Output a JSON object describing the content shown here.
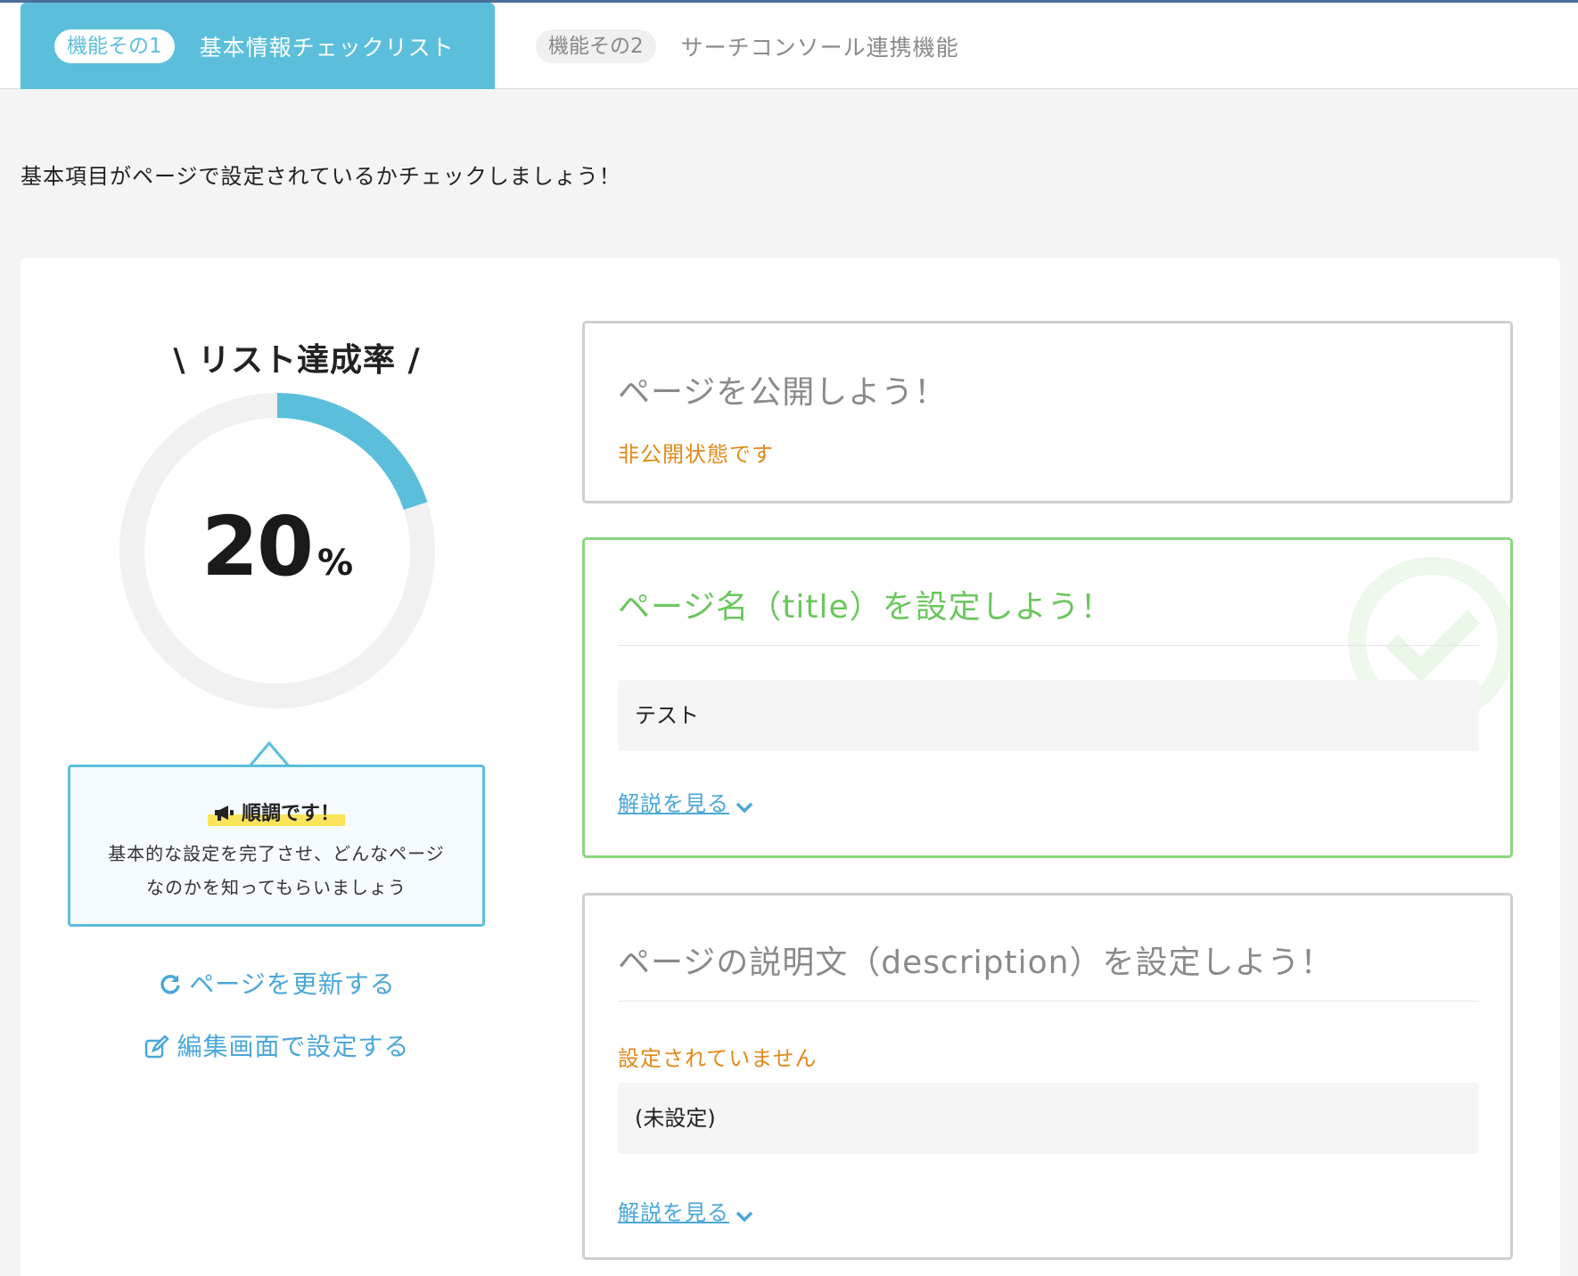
{
  "tabs": [
    {
      "pill": "機能その1",
      "label": "基本情報チェックリスト",
      "active": true
    },
    {
      "pill": "機能その2",
      "label": "サーチコンソール連携機能",
      "active": false
    }
  ],
  "intro": "基本項目がページで設定されているかチェックしましょう！",
  "progress": {
    "title": "\\ リスト達成率 /",
    "value": "20",
    "unit": "%",
    "fraction": 0.2,
    "accent_color": "#5bbfdc"
  },
  "message": {
    "heading": "順調です！",
    "icon": "megaphone-icon",
    "line1": "基本的な設定を完了させ、どんなページ",
    "line2": "なのかを知ってもらいましょう"
  },
  "actions": {
    "refresh": "ページを更新する",
    "edit": "編集画面で設定する"
  },
  "cards": [
    {
      "title": "ページを公開しよう！",
      "status": "非公開状態です",
      "done": false
    },
    {
      "title": "ページ名（title）を設定しよう！",
      "value": "テスト",
      "more": "解説を見る",
      "done": true
    },
    {
      "title": "ページの説明文（description）を設定しよう！",
      "status": "設定されていません",
      "value": "(未設定)",
      "more": "解説を見る",
      "done": false
    }
  ],
  "colors": {
    "accent": "#5bbfdc",
    "success": "#6bc75e",
    "warning": "#e08a1a",
    "link": "#4aa7d8"
  }
}
